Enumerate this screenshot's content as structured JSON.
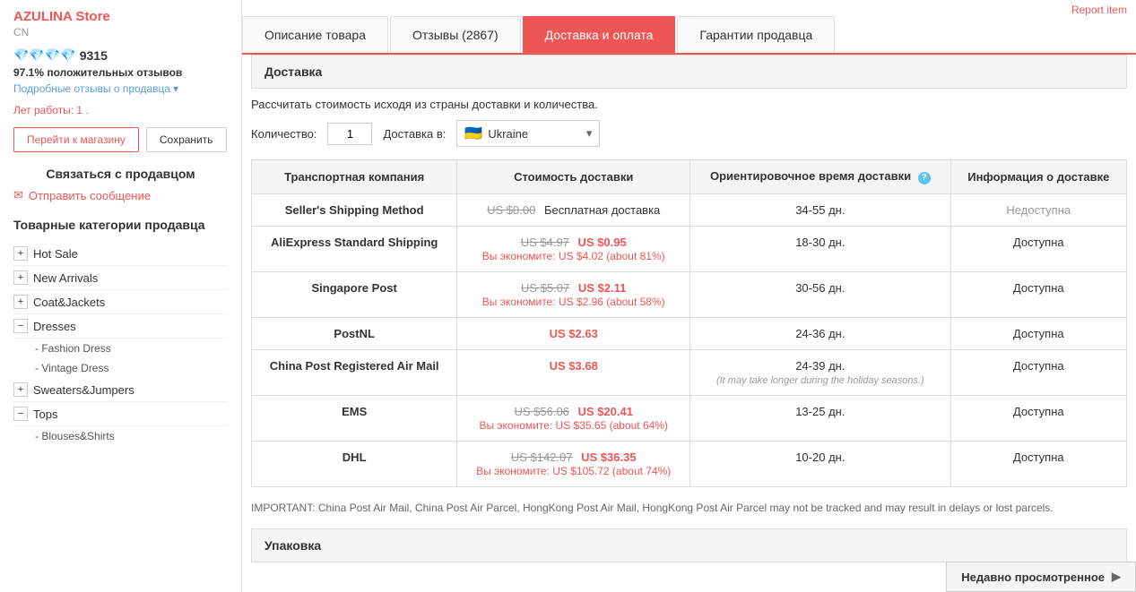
{
  "report_item": "Report item",
  "sidebar": {
    "store_name": "AZULINA Store",
    "store_country": "CN",
    "diamonds": "💎💎💎💎",
    "rating_score": "9315",
    "positive_pct": "97.1%",
    "positive_label": "положительных отзывов",
    "details_link": "Подробные отзывы о продавца",
    "years_label": "Лет работы:",
    "years_value": "1",
    "btn_store": "Перейти к магазину",
    "btn_save": "Сохранить",
    "contact_label": "Связаться с продавцом",
    "send_msg": "Отправить сообщение",
    "categories_title": "Товарные категории продавца",
    "categories": [
      {
        "id": "hot-sale",
        "label": "Hot Sale",
        "toggle": "+",
        "expanded": false,
        "subs": []
      },
      {
        "id": "new-arrivals",
        "label": "New Arrivals",
        "toggle": "+",
        "expanded": false,
        "subs": []
      },
      {
        "id": "coat-jackets",
        "label": "Coat&Jackets",
        "toggle": "+",
        "expanded": false,
        "subs": []
      },
      {
        "id": "dresses",
        "label": "Dresses",
        "toggle": "−",
        "expanded": true,
        "subs": [
          "Fashion Dress",
          "Vintage Dress"
        ]
      },
      {
        "id": "sweaters-jumpers",
        "label": "Sweaters&Jumpers",
        "toggle": "+",
        "expanded": false,
        "subs": []
      },
      {
        "id": "tops",
        "label": "Tops",
        "toggle": "−",
        "expanded": true,
        "subs": [
          "Blouses&Shirts"
        ]
      }
    ]
  },
  "tabs": [
    {
      "id": "description",
      "label": "Описание товара",
      "active": false
    },
    {
      "id": "reviews",
      "label": "Отзывы (2867)",
      "active": false
    },
    {
      "id": "delivery",
      "label": "Доставка и оплата",
      "active": true
    },
    {
      "id": "guarantee",
      "label": "Гарантии продавца",
      "active": false
    }
  ],
  "content": {
    "section_delivery": "Доставка",
    "calc_info": "Рассчитать стоимость исходя из страны доставки и количества.",
    "qty_label": "Количество:",
    "qty_value": "1",
    "dest_label": "Доставка в:",
    "dest_country": "Ukraine",
    "table_headers": [
      "Транспортная компания",
      "Стоимость доставки",
      "Ориентировочное время доставки",
      "Информация о доставке"
    ],
    "rows": [
      {
        "company": "Seller's Shipping Method",
        "price_old": "",
        "price_free": "US $0.00",
        "price_label": "Бесплатная доставка",
        "price_new": "",
        "save_text": "",
        "time": "34-55 дн.",
        "avail": "Недоступна",
        "avail_class": "not-avail"
      },
      {
        "company": "AliExpress Standard Shipping",
        "price_old": "US $4.97",
        "price_new": "US $0.95",
        "save_text": "Вы экономите: US $4.02 (about 81%)",
        "time": "18-30 дн.",
        "avail": "Доступна",
        "avail_class": "avail"
      },
      {
        "company": "Singapore Post",
        "price_old": "US $5.07",
        "price_new": "US $2.11",
        "save_text": "Вы экономите: US $2.96 (about 58%)",
        "time": "30-56 дн.",
        "avail": "Доступна",
        "avail_class": "avail"
      },
      {
        "company": "PostNL",
        "price_old": "",
        "price_new": "US $2.63",
        "save_text": "",
        "time": "24-36 дн.",
        "avail": "Доступна",
        "avail_class": "avail"
      },
      {
        "company": "China Post Registered Air Mail",
        "price_old": "",
        "price_new": "US $3.68",
        "save_text": "",
        "time": "24-39 дн.",
        "time_note": "(It may take longer during the holiday seasons.)",
        "avail": "Доступна",
        "avail_class": "avail"
      },
      {
        "company": "EMS",
        "price_old": "US $56.06",
        "price_new": "US $20.41",
        "save_text": "Вы экономите: US $35.65 (about 64%)",
        "time": "13-25 дн.",
        "avail": "Доступна",
        "avail_class": "avail"
      },
      {
        "company": "DHL",
        "price_old": "US $142.07",
        "price_new": "US $36.35",
        "save_text": "Вы экономите: US $105.72 (about 74%)",
        "time": "10-20 дн.",
        "avail": "Доступна",
        "avail_class": "avail"
      }
    ],
    "important_note": "IMPORTANT: China Post Air Mail, China Post Air Parcel, HongKong Post Air Mail, HongKong Post Air Parcel may not be tracked and may result in delays or lost parcels.",
    "section_packaging": "Упаковка",
    "recently_viewed": "Недавно просмотренное"
  }
}
